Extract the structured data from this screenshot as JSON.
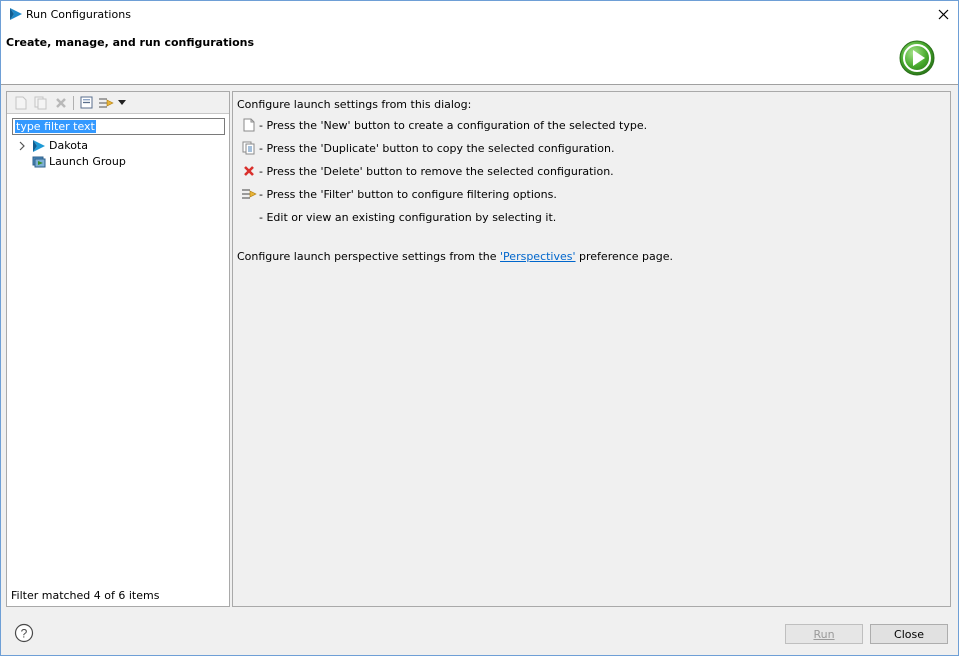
{
  "window": {
    "title": "Run Configurations",
    "heading": "Create, manage, and run configurations",
    "accent_color": "#0078d7"
  },
  "toolbar": {
    "icons": [
      "new-config-icon",
      "duplicate-icon",
      "delete-icon",
      "collapse-all-icon",
      "filter-icon",
      "dropdown-arrow-icon"
    ]
  },
  "filter": {
    "value": "type filter text",
    "status": "Filter matched 4 of 6 items"
  },
  "tree": {
    "items": [
      {
        "label": "Dakota",
        "icon": "dakota-icon",
        "expandable": true
      },
      {
        "label": "Launch Group",
        "icon": "launch-group-icon",
        "expandable": false
      }
    ]
  },
  "help": {
    "intro": "Configure launch settings from this dialog:",
    "rows": [
      {
        "icon": "new-config-icon",
        "text": "- Press the 'New' button to create a configuration of the selected type."
      },
      {
        "icon": "duplicate-icon",
        "text": "- Press the 'Duplicate' button to copy the selected configuration."
      },
      {
        "icon": "delete-icon",
        "text": "- Press the 'Delete' button to remove the selected configuration."
      },
      {
        "icon": "filter-icon",
        "text": "- Press the 'Filter' button to configure filtering options."
      },
      {
        "icon": "",
        "text": "- Edit or view an existing configuration by selecting it."
      }
    ],
    "perspective_prefix": "Configure launch perspective settings from the ",
    "perspective_link": "'Perspectives'",
    "perspective_suffix": " preference page."
  },
  "buttons": {
    "run": "Run",
    "close": "Close"
  }
}
